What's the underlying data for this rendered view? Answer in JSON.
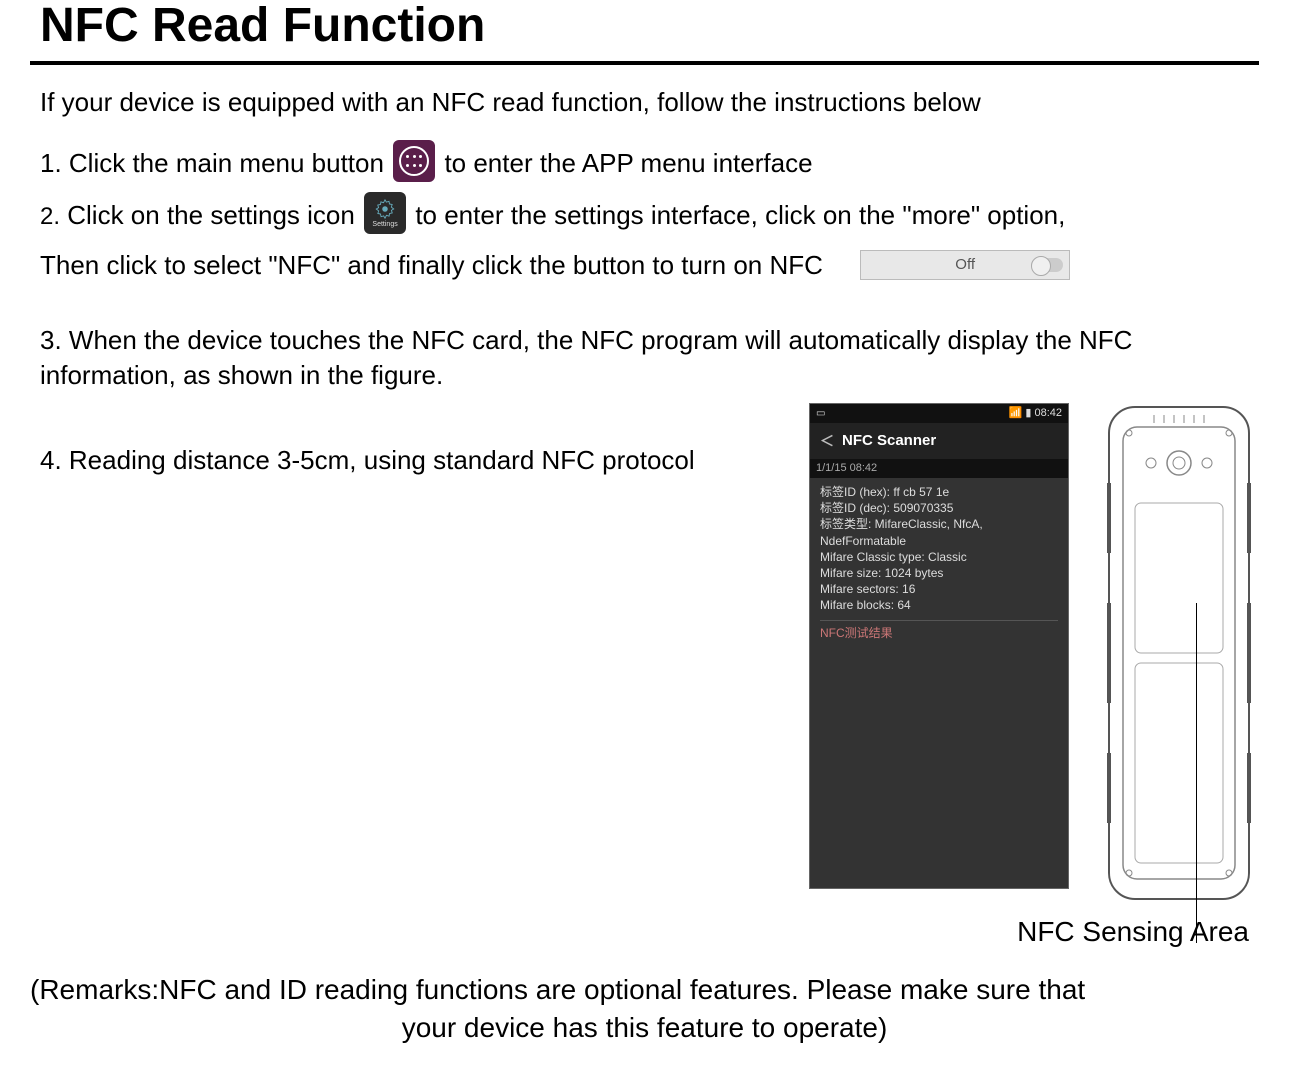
{
  "title": "NFC Read Function",
  "intro": "If your device is equipped with an NFC read function, follow the instructions below",
  "steps": {
    "s1a": "1. Click the main menu button",
    "s1b": "to enter the APP menu interface",
    "s2num": "2.",
    "s2a": "Click on the settings icon",
    "s2b": "to enter the settings interface, click on the \"more\" option,",
    "s2c": "Then click to select \"NFC\" and finally click the button to turn on NFC",
    "s3": "3. When the device touches the NFC card, the NFC program will automatically display the NFC information, as shown in the figure.",
    "s4": "4. Reading distance 3-5cm, using standard NFC protocol"
  },
  "icons": {
    "settings_label": "Settings"
  },
  "toggle": {
    "label": "Off"
  },
  "phone": {
    "status_time": "08:42",
    "app_title": "NFC Scanner",
    "date": "1/1/15 08:42",
    "lines": [
      "标签ID (hex): ff cb 57 1e",
      "标签ID (dec): 509070335",
      "标签类型: MifareClassic, NfcA,",
      "NdefFormatable",
      "Mifare Classic type: Classic",
      "Mifare size: 1024 bytes",
      "Mifare sectors: 16",
      "Mifare blocks: 64"
    ],
    "section": "NFC测试结果"
  },
  "sensing_label": "NFC Sensing Area",
  "remarks_l1": "(Remarks:NFC and ID reading functions are optional features. Please make sure that",
  "remarks_l2": "your device has this feature to operate)"
}
